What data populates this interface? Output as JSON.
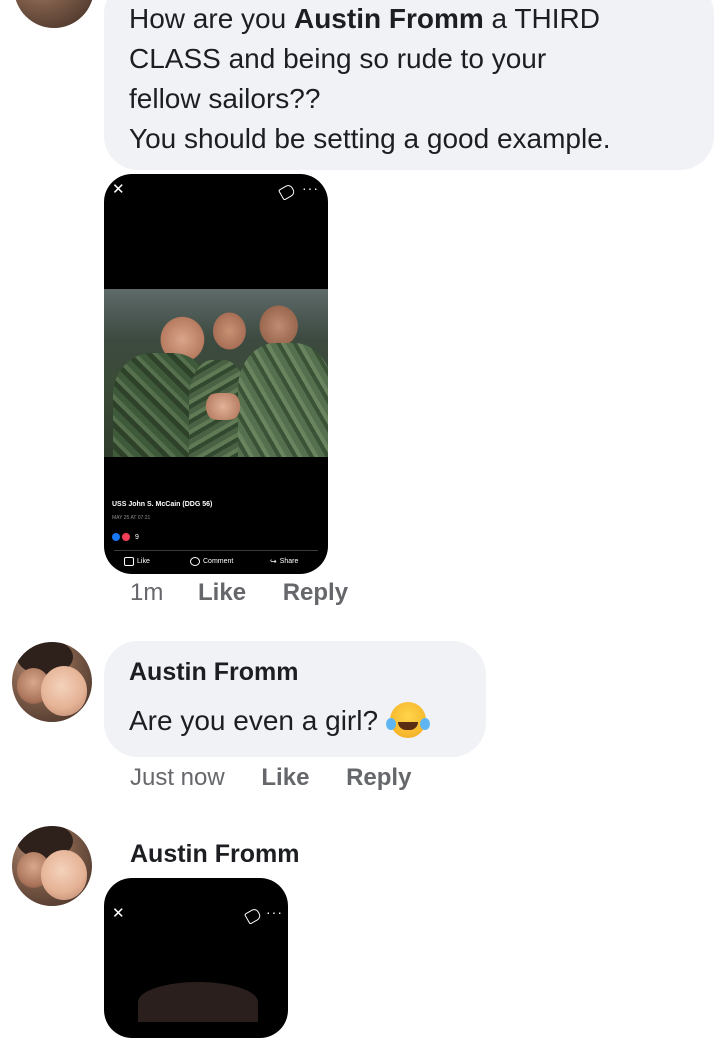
{
  "comments": [
    {
      "text_parts": [
        "How are you ",
        "Austin Fromm",
        " a THIRD\nCLASS and being so rude to your\nfellow sailors??\nYou should be setting a good example."
      ],
      "attachment": {
        "page_name": "USS John S. McCain (DDG 56)",
        "date": "MAY 25 AT 07:21",
        "reaction_count": "9",
        "actions": [
          "Like",
          "Comment",
          "Share"
        ]
      },
      "time": "1m",
      "like_label": "Like",
      "reply_label": "Reply"
    },
    {
      "author": "Austin Fromm",
      "text": "Are you even a girl?",
      "emoji": "face-with-tears-of-joy",
      "time": "Just now",
      "like_label": "Like",
      "reply_label": "Reply"
    },
    {
      "author": "Austin Fromm"
    }
  ],
  "colors": {
    "bubble": "#f0f2f5",
    "meta_text": "#65676b",
    "primary_text": "#1c1e21"
  }
}
